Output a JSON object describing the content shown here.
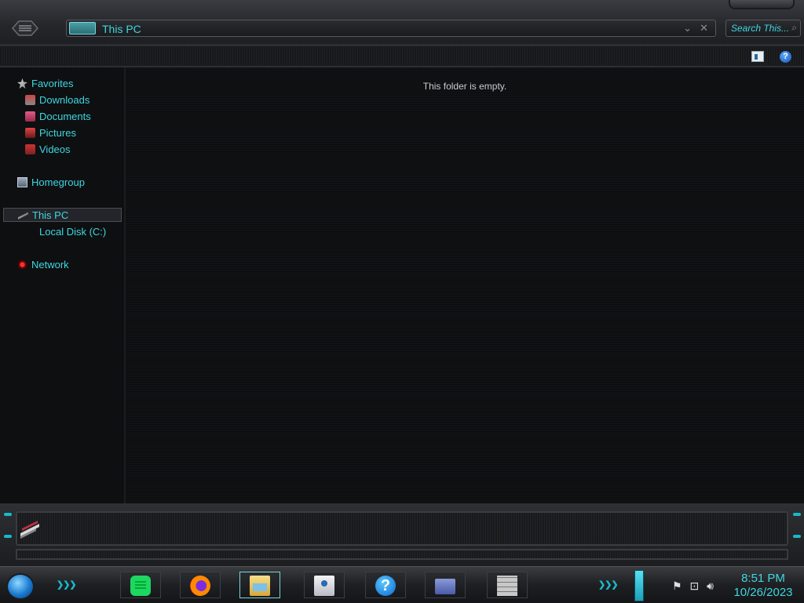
{
  "window": {
    "address_path": "This PC",
    "search_placeholder": "Search This...",
    "empty_message": "This folder is empty."
  },
  "navigation": {
    "favorites": "Favorites",
    "favorites_items": [
      "Downloads",
      "Documents",
      "Pictures",
      "Videos"
    ],
    "homegroup": "Homegroup",
    "this_pc": "This PC",
    "this_pc_items": [
      "Local Disk (C:)"
    ],
    "network": "Network",
    "selected": "This PC"
  },
  "taskbar": {
    "pinned": [
      "notes-app",
      "firefox",
      "file-explorer",
      "contacts",
      "help",
      "id-card-app",
      "firewall"
    ],
    "active": "file-explorer",
    "clock_time": "8:51 PM",
    "clock_date": "10/26/2023",
    "tray_icons": [
      "flag-icon",
      "network-icon",
      "volume-icon"
    ]
  },
  "colors": {
    "accent": "#3fd6e0",
    "background": "#0d0e10",
    "text_muted": "#c8ccd0"
  }
}
